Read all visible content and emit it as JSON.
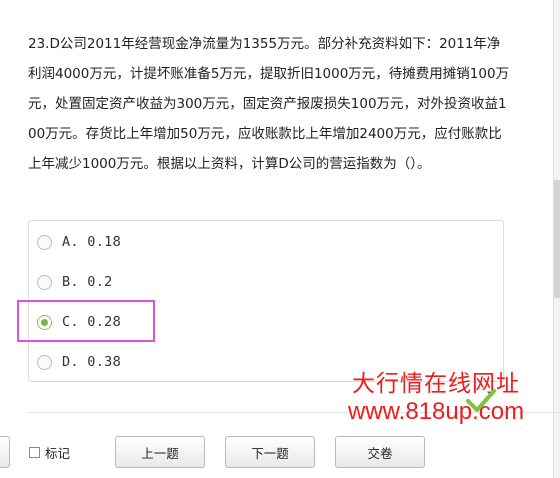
{
  "question": {
    "text": "23.D公司2011年经营现金净流量为1355万元。部分补充资料如下：2011年净利润4000万元，计提坏账准备5万元，提取折旧1000万元，待摊费用摊销100万元，处置固定资产收益为300万元，固定资产报废损失100万元，对外投资收益100万元。存货比上年增加50万元，应收账款比上年增加2400万元，应付账款比上年减少1000万元。根据以上资料，计算D公司的营运指数为（）。"
  },
  "options": [
    {
      "label": "A. 0.18",
      "selected": false
    },
    {
      "label": "B. 0.2",
      "selected": false
    },
    {
      "label": "C. 0.28",
      "selected": true
    },
    {
      "label": "D. 0.38",
      "selected": false
    }
  ],
  "watermark": {
    "line1": "大行情在线网址",
    "line2": "www.818up.com",
    "color": "#ee1c1c"
  },
  "toolbar": {
    "mark_label": "标记",
    "prev_label": "上一题",
    "next_label": "下一题",
    "submit_label": "交卷"
  },
  "colors": {
    "highlight_box": "#e050d8",
    "selected_radio": "#7cb342",
    "check_mark": "#7dc242"
  }
}
